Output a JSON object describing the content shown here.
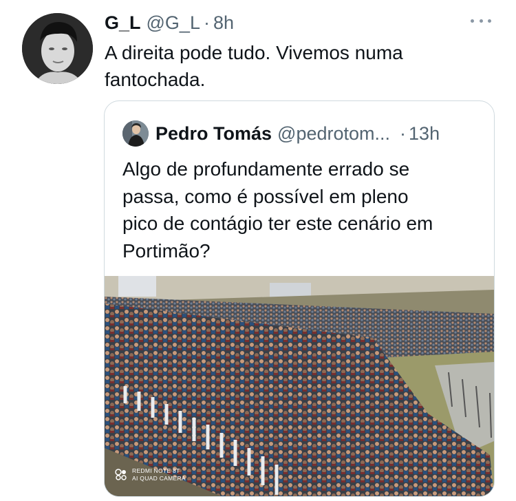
{
  "tweet": {
    "author": {
      "display_name": "G_L",
      "handle": "@G_L",
      "avatar_icon": "user-avatar-photo"
    },
    "separator": "·",
    "time": "8h",
    "more_icon": "more-options-icon",
    "text_lines": [
      "A direita pode tudo. Vivemos numa",
      "fantochada."
    ]
  },
  "quoted_tweet": {
    "author": {
      "display_name": "Pedro Tomás",
      "handle": "@pedrotom...",
      "avatar_icon": "user-avatar-photo"
    },
    "separator": "·",
    "time": "13h",
    "text_lines": [
      "Algo de profundamente errado se",
      "passa, como é possível em pleno",
      "pico de contágio ter este cenário em",
      "Portimão?"
    ],
    "media": {
      "description_icon": "crowd-photo",
      "watermark_lines": [
        "REDMI NOTE 8T",
        "AI QUAD CAMERA"
      ]
    }
  },
  "colors": {
    "text_primary": "#0f1419",
    "text_secondary": "#536471",
    "border": "#cfd9de"
  }
}
